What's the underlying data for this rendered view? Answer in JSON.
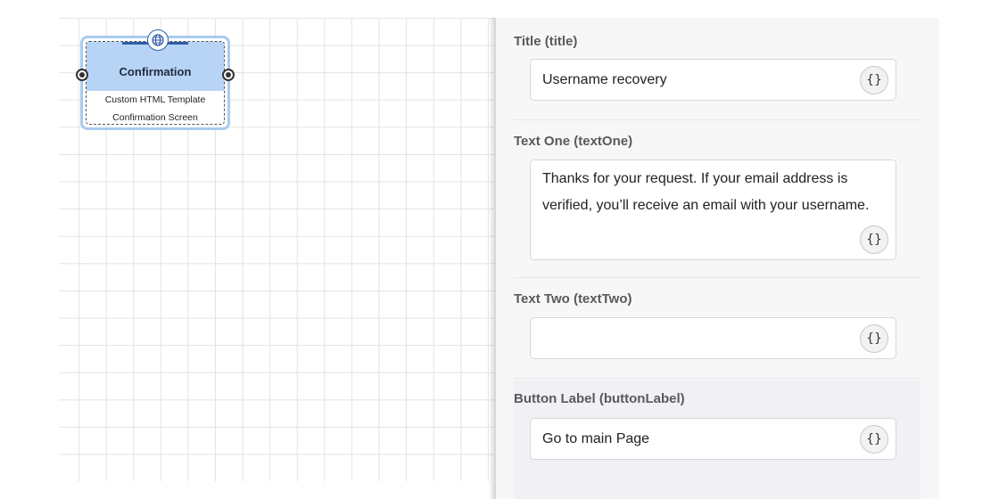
{
  "canvas": {
    "node": {
      "title": "Confirmation",
      "line1": "Custom HTML Template",
      "line2": "Confirmation Screen",
      "icon": "globe-icon",
      "accent": "#b7d4f6"
    }
  },
  "panel": {
    "title_field": {
      "label": "Title (title)",
      "value": "Username recovery",
      "var_label": "{}"
    },
    "text_one_field": {
      "label": "Text One (textOne)",
      "value": "Thanks for your request. If your email address is verified, you’ll receive an email with your username.",
      "var_label": "{}"
    },
    "text_two_field": {
      "label": "Text Two (textTwo)",
      "value": "",
      "var_label": "{}"
    },
    "button_label_field": {
      "label": "Button Label (buttonLabel)",
      "value": "Go to main Page",
      "var_label": "{}"
    }
  }
}
